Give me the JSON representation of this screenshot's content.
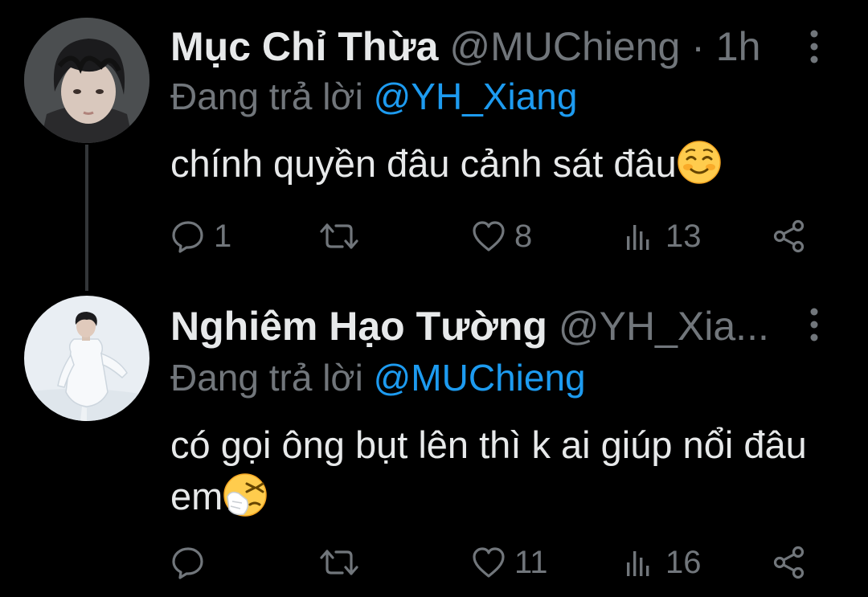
{
  "colors": {
    "background": "#000000",
    "primary_text": "#e7e9ea",
    "secondary_text": "#71767b",
    "accent": "#1d9bf0",
    "thread_line": "#333639"
  },
  "tweets": [
    {
      "avatar_icon": "avatar-photo",
      "display_name": "Mục Chỉ Thừa",
      "handle": "@MUChieng",
      "separator": "·",
      "time": "1h",
      "reply_prefix": "Đang trả lời",
      "reply_to": "@YH_Xiang",
      "text": "chính quyền đâu cảnh sát đâu",
      "emoji": "smiling-face-emoji",
      "actions": {
        "reply_icon": "reply-icon",
        "reply_count": "1",
        "retweet_icon": "retweet-icon",
        "retweet_count": "",
        "like_icon": "heart-icon",
        "like_count": "8",
        "views_icon": "views-icon",
        "views_count": "13",
        "share_icon": "share-icon"
      }
    },
    {
      "avatar_icon": "avatar-photo",
      "display_name": "Nghiêm Hạo Tường",
      "handle": "@YH_Xia...",
      "separator": "",
      "time": "",
      "reply_prefix": "Đang trả lời",
      "reply_to": "@MUChieng",
      "text": "có gọi ông bụt lên thì k ai giúp nổi đâu em",
      "emoji": "sneezing-face-emoji",
      "actions": {
        "reply_icon": "reply-icon",
        "reply_count": "",
        "retweet_icon": "retweet-icon",
        "retweet_count": "",
        "like_icon": "heart-icon",
        "like_count": "11",
        "views_icon": "views-icon",
        "views_count": "16",
        "share_icon": "share-icon"
      }
    }
  ]
}
